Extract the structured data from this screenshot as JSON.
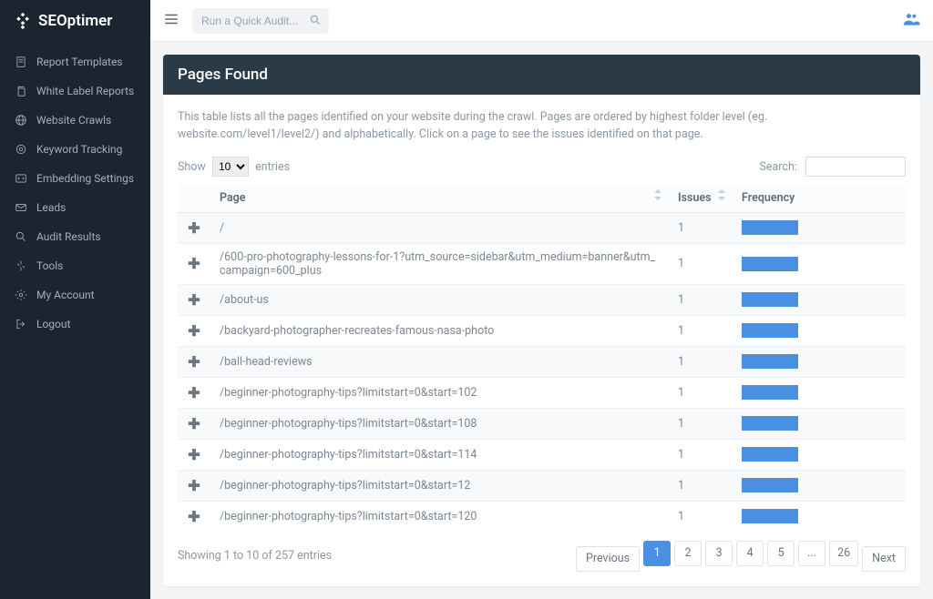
{
  "brand": "SEOptimer",
  "topbar": {
    "search_placeholder": "Run a Quick Audit..."
  },
  "sidebar": {
    "items": [
      {
        "label": "Report Templates",
        "icon": "doc"
      },
      {
        "label": "White Label Reports",
        "icon": "copy"
      },
      {
        "label": "Website Crawls",
        "icon": "globe"
      },
      {
        "label": "Keyword Tracking",
        "icon": "target"
      },
      {
        "label": "Embedding Settings",
        "icon": "embed"
      },
      {
        "label": "Leads",
        "icon": "mail"
      },
      {
        "label": "Audit Results",
        "icon": "search"
      },
      {
        "label": "Tools",
        "icon": "tool"
      },
      {
        "label": "My Account",
        "icon": "gear"
      },
      {
        "label": "Logout",
        "icon": "logout"
      }
    ]
  },
  "panel": {
    "title": "Pages Found",
    "description": "This table lists all the pages identified on your website during the crawl. Pages are ordered by highest folder level (eg. website.com/level1/level2/) and alphabetically. Click on a page to see the issues identified on that page.",
    "show_label_pre": "Show",
    "show_label_post": "entries",
    "show_value": "10",
    "search_label": "Search:",
    "columns": {
      "page": "Page",
      "issues": "Issues",
      "frequency": "Frequency"
    },
    "rows": [
      {
        "page": "/",
        "issues": "1"
      },
      {
        "page": "/600-pro-photography-lessons-for-1?utm_source=sidebar&utm_medium=banner&utm_campaign=600_plus",
        "issues": "1"
      },
      {
        "page": "/about-us",
        "issues": "1"
      },
      {
        "page": "/backyard-photographer-recreates-famous-nasa-photo",
        "issues": "1"
      },
      {
        "page": "/ball-head-reviews",
        "issues": "1"
      },
      {
        "page": "/beginner-photography-tips?limitstart=0&start=102",
        "issues": "1"
      },
      {
        "page": "/beginner-photography-tips?limitstart=0&start=108",
        "issues": "1"
      },
      {
        "page": "/beginner-photography-tips?limitstart=0&start=114",
        "issues": "1"
      },
      {
        "page": "/beginner-photography-tips?limitstart=0&start=12",
        "issues": "1"
      },
      {
        "page": "/beginner-photography-tips?limitstart=0&start=120",
        "issues": "1"
      }
    ],
    "footer_info": "Showing 1 to 10 of 257 entries",
    "pagination": {
      "previous": "Previous",
      "next": "Next",
      "pages": [
        "1",
        "2",
        "3",
        "4",
        "5",
        "...",
        "26"
      ],
      "active": "1"
    }
  }
}
